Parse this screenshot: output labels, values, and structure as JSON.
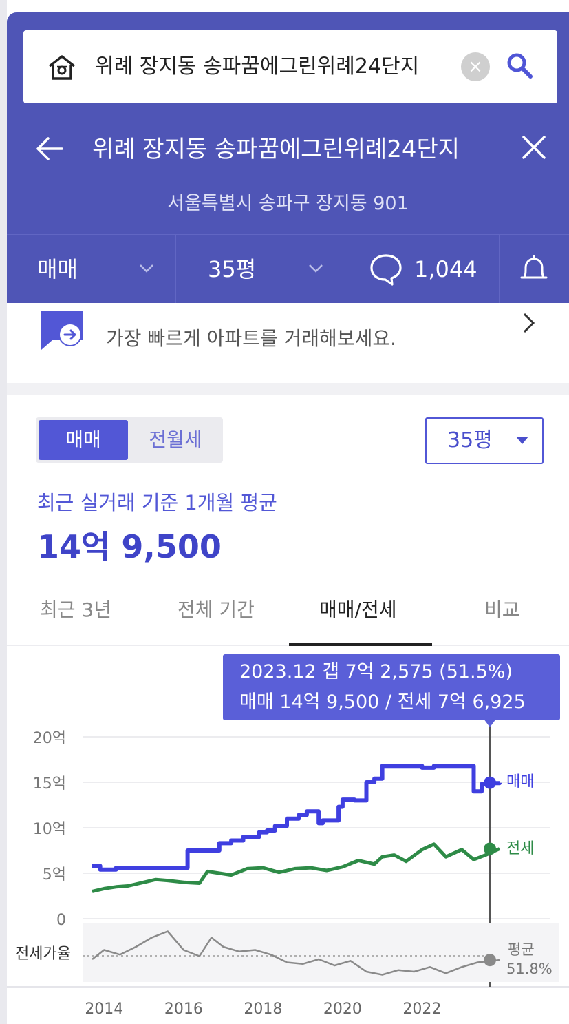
{
  "search": {
    "query": "위례 장지동 송파꿈에그린위례24단지"
  },
  "header": {
    "title": "위례 장지동 송파꿈에그린위례24단지",
    "address": "서울특별시 송파구 장지동 901"
  },
  "filters": {
    "trade_type": "매매",
    "size": "35평",
    "comment_count": "1,044"
  },
  "promo": {
    "text": "가장 빠르게 아파트를 거래해보세요."
  },
  "price_section": {
    "seg_sale": "매매",
    "seg_rent": "전월세",
    "size_select": "35평",
    "avg_label": "최근 실거래 기준 1개월 평균",
    "avg_value": "14억 9,500"
  },
  "tabs": [
    {
      "label": "최근 3년"
    },
    {
      "label": "전체 기간"
    },
    {
      "label": "매매/전세"
    },
    {
      "label": "비교"
    }
  ],
  "tooltip": {
    "line1": "2023.12  갭 7억 2,575 (51.5%)",
    "line2": "매매 14억 9,500 / 전세 7억 6,925"
  },
  "colors": {
    "header": "#4f55b6",
    "accent": "#5257d6",
    "sale": "#3f3fe0",
    "jeonse": "#2e8b47",
    "ratio": "#8a8a8a"
  },
  "chart_data": {
    "type": "line",
    "y_tick_labels": [
      "20억",
      "15억",
      "10억",
      "5억",
      "0"
    ],
    "x_tick_labels": [
      "2014",
      "2016",
      "2018",
      "2020",
      "2022"
    ],
    "ylim": [
      0,
      20
    ],
    "y_unit": "억",
    "ratio_label": "전세가율",
    "ratio_avg_label": "평균",
    "ratio_avg_value": "51.8%",
    "series": [
      {
        "name": "매매",
        "x": [
          2013.7,
          2013.9,
          2014.1,
          2014.3,
          2014.6,
          2015.0,
          2015.5,
          2016.0,
          2016.1,
          2016.5,
          2016.8,
          2016.9,
          2017.2,
          2017.5,
          2017.9,
          2018.1,
          2018.3,
          2018.6,
          2018.9,
          2019.1,
          2019.4,
          2019.5,
          2019.9,
          2020.0,
          2020.3,
          2020.6,
          2020.8,
          2021.0,
          2021.5,
          2022.0,
          2022.3,
          2022.8,
          2023.1,
          2023.3,
          2023.5,
          2023.8,
          2023.95
        ],
        "values": [
          5.8,
          5.4,
          5.4,
          5.6,
          5.6,
          5.6,
          5.6,
          5.6,
          7.5,
          7.5,
          7.5,
          8.3,
          8.6,
          9.0,
          9.5,
          9.7,
          10.2,
          11.0,
          11.4,
          11.8,
          10.5,
          10.8,
          12.3,
          13.1,
          13.0,
          15.0,
          15.4,
          16.8,
          16.8,
          16.6,
          16.8,
          16.8,
          16.8,
          14.0,
          14.8,
          14.9,
          14.95
        ]
      },
      {
        "name": "전세",
        "x": [
          2013.7,
          2014.0,
          2014.3,
          2014.6,
          2015.0,
          2015.3,
          2015.6,
          2016.0,
          2016.4,
          2016.6,
          2016.9,
          2017.2,
          2017.6,
          2018.0,
          2018.4,
          2018.8,
          2019.2,
          2019.6,
          2020.0,
          2020.4,
          2020.8,
          2021.0,
          2021.3,
          2021.6,
          2022.0,
          2022.3,
          2022.6,
          2023.0,
          2023.3,
          2023.6,
          2023.95
        ],
        "values": [
          3.0,
          3.3,
          3.5,
          3.6,
          4.0,
          4.3,
          4.2,
          4.0,
          3.9,
          5.2,
          5.0,
          4.8,
          5.5,
          5.6,
          5.1,
          5.5,
          5.6,
          5.3,
          5.7,
          6.4,
          6.0,
          6.8,
          7.0,
          6.3,
          7.6,
          8.2,
          6.8,
          7.6,
          6.5,
          7.0,
          7.69
        ]
      },
      {
        "name": "전세가율",
        "x": [
          2013.7,
          2014.0,
          2014.4,
          2014.8,
          2015.2,
          2015.6,
          2016.0,
          2016.4,
          2016.7,
          2017.0,
          2017.4,
          2017.8,
          2018.2,
          2018.6,
          2019.0,
          2019.4,
          2019.8,
          2020.2,
          2020.6,
          2021.0,
          2021.4,
          2021.8,
          2022.2,
          2022.6,
          2023.0,
          2023.4,
          2023.95
        ],
        "values": [
          52,
          58,
          55,
          60,
          66,
          70,
          58,
          54,
          66,
          60,
          57,
          58,
          55,
          50,
          49,
          52,
          48,
          51,
          44,
          42,
          45,
          44,
          47,
          43,
          47,
          50,
          51.5
        ]
      }
    ]
  }
}
